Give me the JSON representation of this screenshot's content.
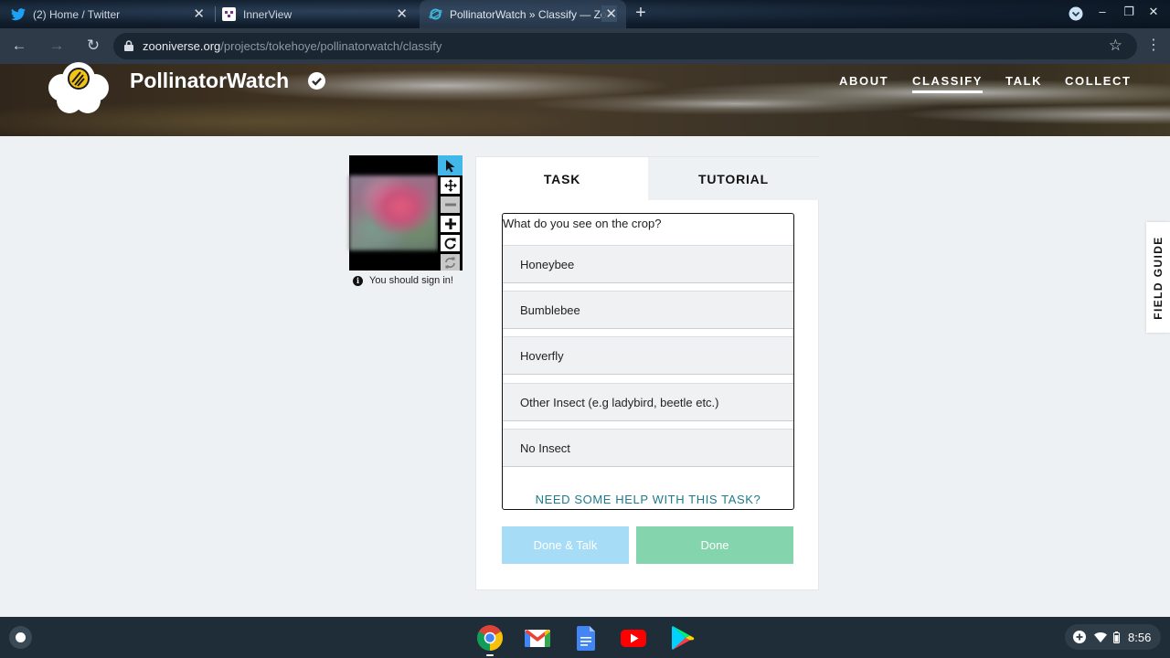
{
  "browser": {
    "tabs": [
      {
        "title": "(2) Home / Twitter",
        "icon": "twitter-icon"
      },
      {
        "title": "InnerView",
        "icon": "innerview-icon"
      },
      {
        "title": "PollinatorWatch » Classify — Zo",
        "icon": "zooniverse-icon",
        "active": true
      }
    ],
    "url_host": "zooniverse.org",
    "url_path": "/projects/tokehoye/pollinatorwatch/classify"
  },
  "project": {
    "title": "PollinatorWatch",
    "nav": [
      "ABOUT",
      "CLASSIFY",
      "TALK",
      "COLLECT"
    ],
    "active_nav": "CLASSIFY"
  },
  "viewer": {
    "tools": [
      "pointer-icon",
      "move-icon",
      "zoom-out-icon",
      "zoom-in-icon",
      "rotate-icon",
      "reset-icon"
    ],
    "signin_note": "You should sign in!"
  },
  "panel": {
    "tabs": [
      "TASK",
      "TUTORIAL"
    ],
    "question": "What do you see on the crop?",
    "answers": [
      "Honeybee",
      "Bumblebee",
      "Hoverfly",
      "Other Insect (e.g ladybird, beetle etc.)",
      "No Insect"
    ],
    "help_link": "NEED SOME HELP WITH THIS TASK?",
    "done_talk_label": "Done & Talk",
    "done_label": "Done"
  },
  "field_guide": "FIELD GUIDE",
  "shelf": {
    "apps": [
      "chrome-icon",
      "gmail-icon",
      "docs-icon",
      "youtube-icon",
      "play-store-icon"
    ],
    "time": "8:56"
  },
  "colors": {
    "done_talk": "#a6dcf5",
    "done": "#84d4ad",
    "help_link": "#1d7a8a",
    "selected_tool": "#42b7ea"
  }
}
